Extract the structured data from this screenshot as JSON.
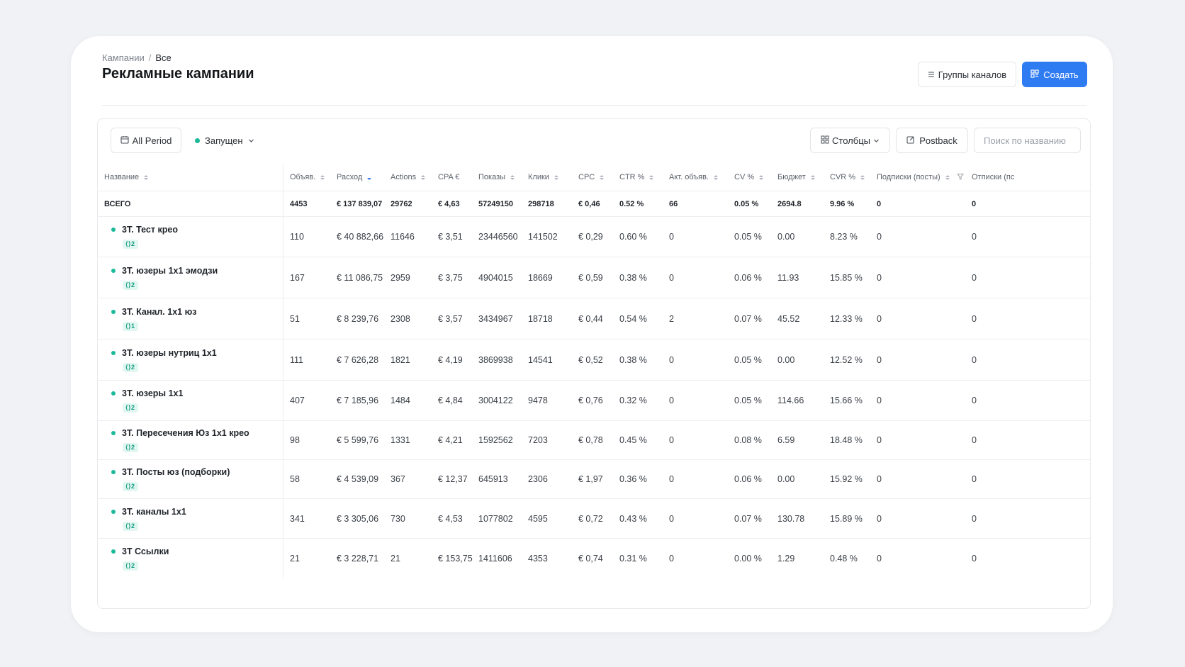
{
  "breadcrumb": {
    "parent": "Кампании",
    "separator": "/",
    "current": "Все"
  },
  "page_title": "Рекламные кампании",
  "header_actions": {
    "groups_label": "Группы каналов",
    "create_label": "Создать"
  },
  "toolbar": {
    "period_label": "All Period",
    "status_label": "Запущен",
    "columns_label": "Столбцы",
    "postback_label": "Postback",
    "search_placeholder": "Поиск по названию"
  },
  "table": {
    "columns": [
      "Название",
      "Объяв.",
      "Расход",
      "Actions",
      "CPA €",
      "Показы",
      "Клики",
      "CPC",
      "CTR %",
      "Акт. объяв.",
      "CV %",
      "Бюджет",
      "CVR %",
      "Подписки (посты)",
      "Отписки (пс"
    ],
    "total": [
      "ВСЕГО",
      "4453",
      "€ 137 839,07",
      "29762",
      "€ 4,63",
      "57249150",
      "298718",
      "€ 0,46",
      "0.52 %",
      "66",
      "0.05 %",
      "2694.8",
      "9.96 %",
      "0",
      "0"
    ],
    "rows": [
      {
        "name": "3Т. Тест крео",
        "tag": "⟨⟩2",
        "cells": [
          "110",
          "€ 40 882,66",
          "11646",
          "€ 3,51",
          "23446560",
          "141502",
          "€ 0,29",
          "0.60 %",
          "0",
          "0.05 %",
          "0.00",
          "8.23 %",
          "0",
          "0"
        ]
      },
      {
        "name": "3Т. юзеры 1х1 эмодзи",
        "tag": "⟨⟩2",
        "cells": [
          "167",
          "€ 11 086,75",
          "2959",
          "€ 3,75",
          "4904015",
          "18669",
          "€ 0,59",
          "0.38 %",
          "0",
          "0.06 %",
          "11.93",
          "15.85 %",
          "0",
          "0"
        ]
      },
      {
        "name": "3Т. Канал. 1х1 юз",
        "tag": "⟨⟩1",
        "cells": [
          "51",
          "€ 8 239,76",
          "2308",
          "€ 3,57",
          "3434967",
          "18718",
          "€ 0,44",
          "0.54 %",
          "2",
          "0.07 %",
          "45.52",
          "12.33 %",
          "0",
          "0"
        ]
      },
      {
        "name": "3Т. юзеры нутриц 1х1",
        "tag": "⟨⟩2",
        "cells": [
          "111",
          "€ 7 626,28",
          "1821",
          "€ 4,19",
          "3869938",
          "14541",
          "€ 0,52",
          "0.38 %",
          "0",
          "0.05 %",
          "0.00",
          "12.52 %",
          "0",
          "0"
        ]
      },
      {
        "name": "3Т. юзеры 1х1",
        "tag": "⟨⟩2",
        "cells": [
          "407",
          "€ 7 185,96",
          "1484",
          "€ 4,84",
          "3004122",
          "9478",
          "€ 0,76",
          "0.32 %",
          "0",
          "0.05 %",
          "114.66",
          "15.66 %",
          "0",
          "0"
        ]
      },
      {
        "name": "3Т. Пересечения Юз 1х1 крео",
        "tag": "⟨⟩2",
        "cells": [
          "98",
          "€ 5 599,76",
          "1331",
          "€ 4,21",
          "1592562",
          "7203",
          "€ 0,78",
          "0.45 %",
          "0",
          "0.08 %",
          "6.59",
          "18.48 %",
          "0",
          "0"
        ]
      },
      {
        "name": "3Т. Посты юз (подборки)",
        "tag": "⟨⟩2",
        "cells": [
          "58",
          "€ 4 539,09",
          "367",
          "€ 12,37",
          "645913",
          "2306",
          "€ 1,97",
          "0.36 %",
          "0",
          "0.06 %",
          "0.00",
          "15.92 %",
          "0",
          "0"
        ]
      },
      {
        "name": "3Т. каналы 1х1",
        "tag": "⟨⟩2",
        "cells": [
          "341",
          "€ 3 305,06",
          "730",
          "€ 4,53",
          "1077802",
          "4595",
          "€ 0,72",
          "0.43 %",
          "0",
          "0.07 %",
          "130.78",
          "15.89 %",
          "0",
          "0"
        ]
      },
      {
        "name": "3Т Ссылки",
        "tag": "⟨⟩2",
        "cells": [
          "21",
          "€ 3 228,71",
          "21",
          "€ 153,75",
          "1411606",
          "4353",
          "€ 0,74",
          "0.31 %",
          "0",
          "0.00 %",
          "1.29",
          "0.48 %",
          "0",
          "0"
        ]
      }
    ]
  },
  "colors": {
    "accent": "#2f7bf2",
    "status": "#1bb89a",
    "tag_bg": "#e2f7f1"
  },
  "icons": [
    "menu-icon",
    "qr-icon",
    "calendar-icon",
    "chevron-down-icon",
    "columns-grid-icon",
    "edit-icon",
    "filter-icon"
  ]
}
